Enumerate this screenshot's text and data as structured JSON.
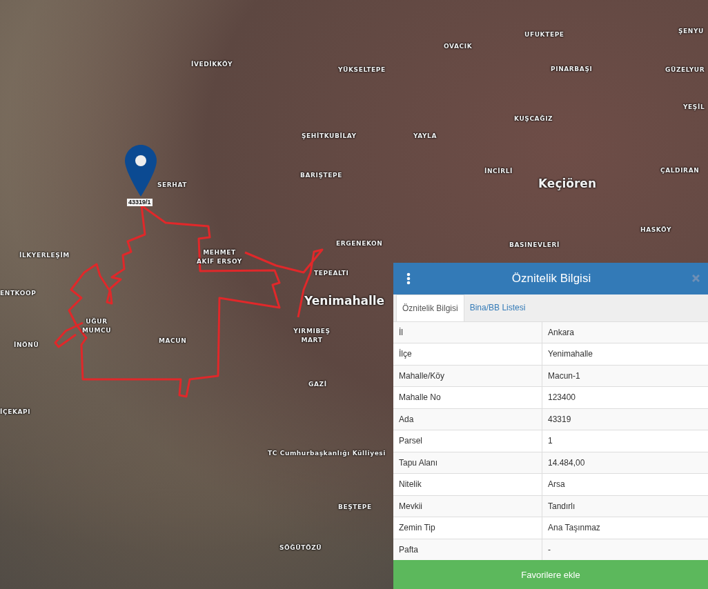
{
  "map": {
    "labels": [
      {
        "text": "İVEDİKKÖY"
      },
      {
        "text": "YÜKSELTEPE"
      },
      {
        "text": "OVACIK"
      },
      {
        "text": "UFUKTEPE"
      },
      {
        "text": "ŞENYU"
      },
      {
        "text": "PINARBAŞI"
      },
      {
        "text": "GÜZELYUR"
      },
      {
        "text": "YEŞİL"
      },
      {
        "text": "KUŞCAĞIZ"
      },
      {
        "text": "ŞEHİTKUBİLAY"
      },
      {
        "text": "YAYLA"
      },
      {
        "text": "İNCİRLİ"
      },
      {
        "text": "Keçiören"
      },
      {
        "text": "ÇALDIRAN"
      },
      {
        "text": "SERHAT"
      },
      {
        "text": "BARIŞTEPE"
      },
      {
        "text": "HASKÖY"
      },
      {
        "text": "ERGENEKON"
      },
      {
        "text": "BASINEVLERİ"
      },
      {
        "text": "İLKYERLEŞİM"
      },
      {
        "text": "MEHMET AKİF ERSOY"
      },
      {
        "text": "TEPEALTI"
      },
      {
        "text": "ENTKOOP"
      },
      {
        "text": "Yenimahalle"
      },
      {
        "text": "UĞUR MUMCU"
      },
      {
        "text": "YIRMIBEŞ MART"
      },
      {
        "text": "İNÖNÜ"
      },
      {
        "text": "MACUN"
      },
      {
        "text": "GAZİ"
      },
      {
        "text": "İÇEKAPI"
      },
      {
        "text": "TC Cumhurbaşkanlığı Külliyesi"
      },
      {
        "text": "BEŞTEPE"
      },
      {
        "text": "SÖĞÜTÖZÜ"
      }
    ],
    "pin_label": "43319/1"
  },
  "panel": {
    "title": "Öznitelik Bilgisi",
    "tabs": [
      {
        "label": "Öznitelik Bilgisi",
        "selected": true
      },
      {
        "label": "Bina/BB Listesi",
        "selected": false
      }
    ],
    "rows": [
      {
        "label": "İl",
        "value": "Ankara"
      },
      {
        "label": "İlçe",
        "value": "Yenimahalle"
      },
      {
        "label": "Mahalle/Köy",
        "value": "Macun-1"
      },
      {
        "label": "Mahalle No",
        "value": "123400"
      },
      {
        "label": "Ada",
        "value": "43319"
      },
      {
        "label": "Parsel",
        "value": "1"
      },
      {
        "label": "Tapu Alanı",
        "value": "14.484,00"
      },
      {
        "label": "Nitelik",
        "value": "Arsa"
      },
      {
        "label": "Mevkii",
        "value": "Tandırlı"
      },
      {
        "label": "Zemin Tip",
        "value": "Ana Taşınmaz"
      },
      {
        "label": "Pafta",
        "value": "-"
      }
    ],
    "button": "Favorilere ekle"
  }
}
